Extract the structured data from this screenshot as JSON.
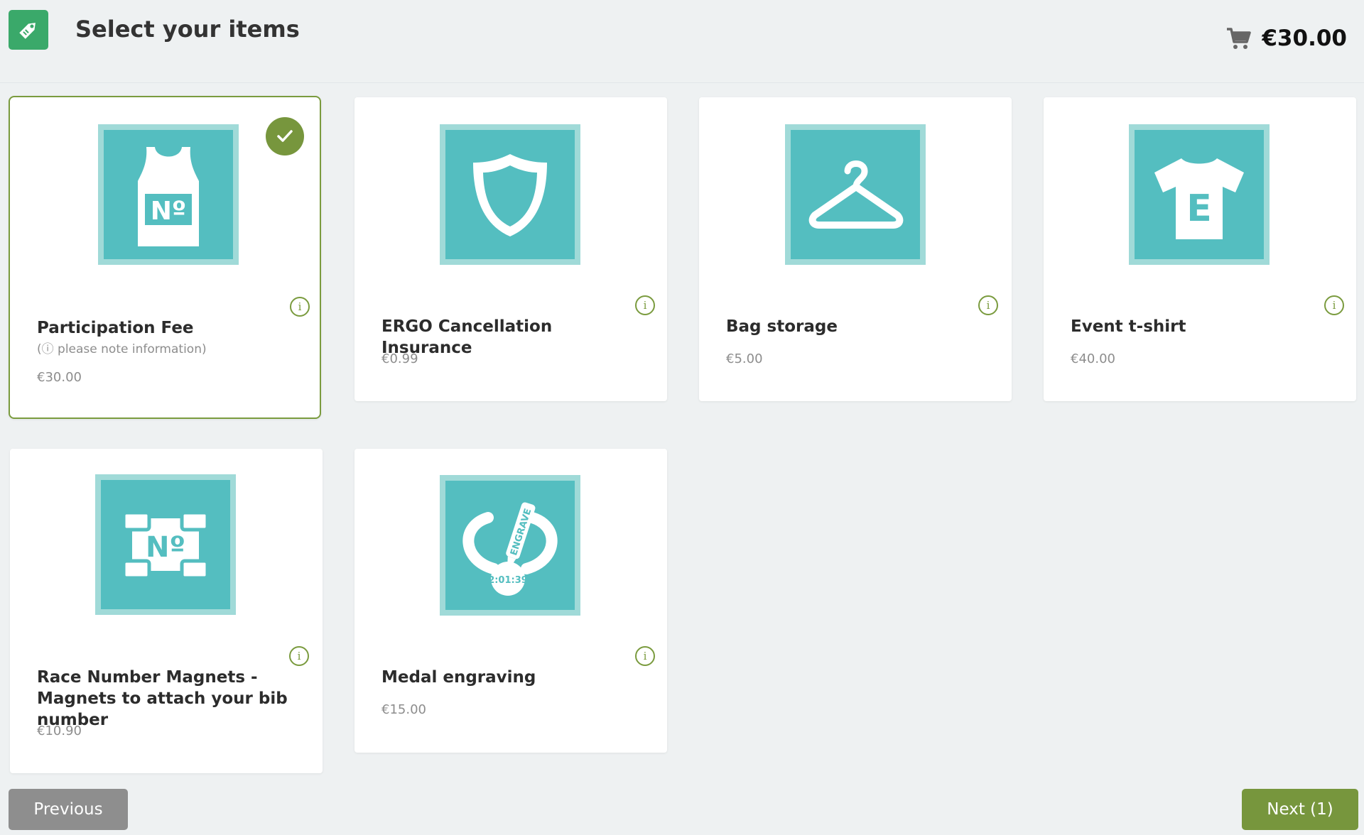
{
  "header": {
    "title": "Select your items",
    "cart_total": "€30.00"
  },
  "items": [
    {
      "name": "Participation Fee",
      "note": "(ⓘ please note information)",
      "price": "€30.00",
      "selected": true,
      "icon": "tank-top-bib-icon"
    },
    {
      "name": "ERGO Cancellation Insurance",
      "price": "€0.99",
      "selected": false,
      "icon": "shield-icon"
    },
    {
      "name": "Bag storage",
      "price": "€5.00",
      "selected": false,
      "icon": "hanger-icon"
    },
    {
      "name": "Event t-shirt",
      "price": "€40.00",
      "selected": false,
      "icon": "tshirt-icon"
    },
    {
      "name": "Race Number Magnets - Magnets to attach your bib number",
      "price": "€10.90",
      "selected": false,
      "icon": "bib-magnets-icon"
    },
    {
      "name": "Medal engraving",
      "price": "€15.00",
      "selected": false,
      "icon": "medal-engraving-icon"
    }
  ],
  "icon_texts": {
    "bib": "Nº",
    "tshirt": "E",
    "engrave": "ENGRAVE",
    "time": "2:01:39"
  },
  "info_glyph": "i",
  "buttons": {
    "previous": "Previous",
    "next": "Next (1)"
  },
  "colors": {
    "accent_green": "#77963d",
    "tile_teal": "#54bec0",
    "tile_border": "#a0dad8",
    "logo_green": "#3aa96a"
  }
}
